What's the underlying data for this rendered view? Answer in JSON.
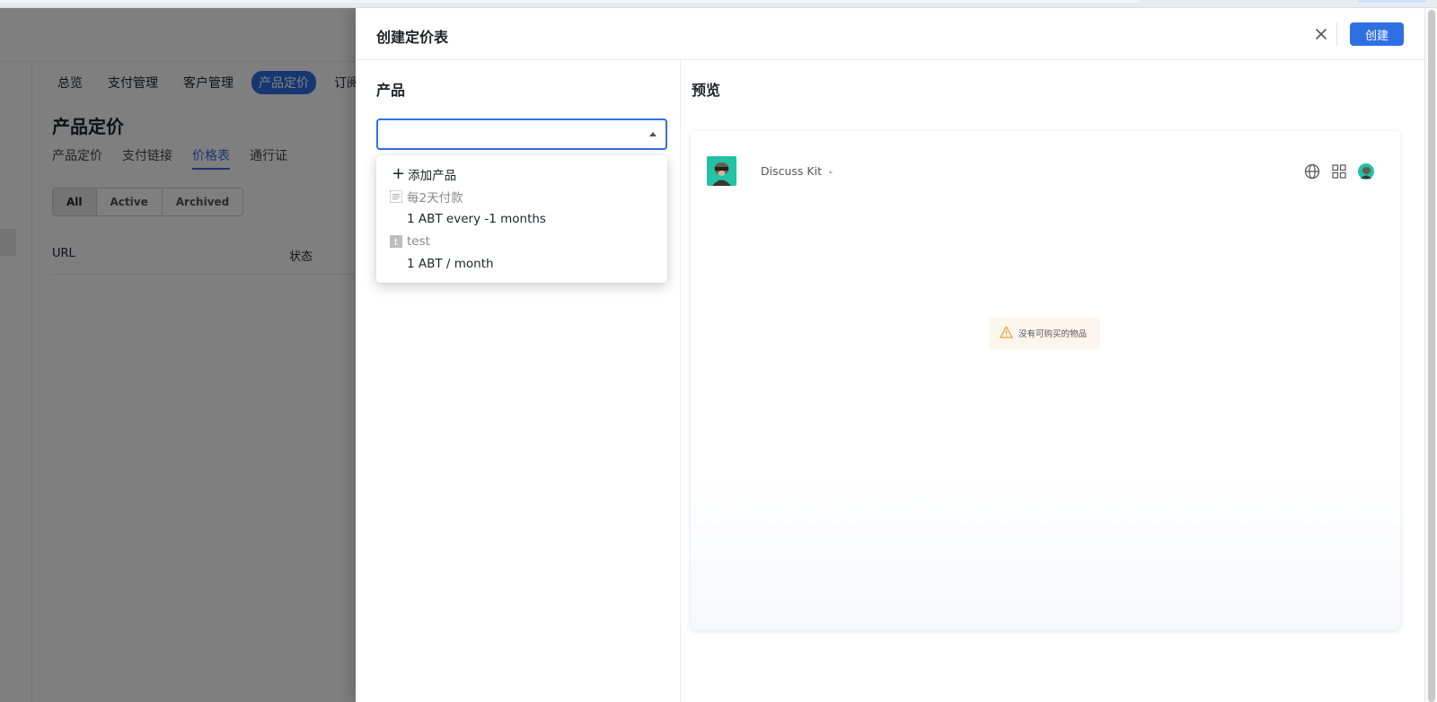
{
  "background": {
    "nav": [
      "总览",
      "支付管理",
      "客户管理",
      "产品定价",
      "订阅和"
    ],
    "nav_active_index": 3,
    "page_title": "产品定价",
    "sub_tabs": [
      "产品定价",
      "支付链接",
      "价格表",
      "通行证"
    ],
    "sub_tab_active_index": 2,
    "filters": [
      "All",
      "Active",
      "Archived"
    ],
    "filter_active_index": 0,
    "table_headers": [
      "URL",
      "状态"
    ]
  },
  "drawer": {
    "title": "创建定价表",
    "create_label": "创建",
    "product_label": "产品",
    "preview_label": "预览",
    "select_value": "",
    "dropdown": {
      "add_label": "添加产品",
      "groups": [
        {
          "name": "每2天付款",
          "icon": "product-image-icon",
          "prices": [
            "1 ABT every -1 months"
          ]
        },
        {
          "name": "test",
          "icon": "t-letter-icon",
          "prices": [
            "1 ABT / month"
          ]
        }
      ]
    },
    "preview": {
      "app_name": "Discuss Kit",
      "empty_message": "没有可购买的物品",
      "icons": [
        "globe-icon",
        "apps-grid-icon",
        "avatar-icon"
      ]
    }
  },
  "colors": {
    "primary": "#2f6fe4",
    "warning_bg": "#fdf6ec",
    "warning_icon": "#e6a23c",
    "logo_bg": "#22c2a7"
  }
}
